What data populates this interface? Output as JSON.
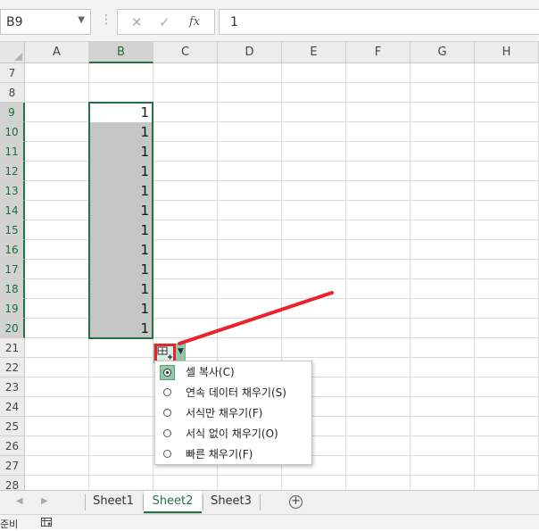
{
  "formula_bar": {
    "name_box": "B9",
    "separator": "⋮",
    "cancel_icon": "✕",
    "enter_icon": "✓",
    "fx_label": "fx",
    "value": "1"
  },
  "columns": [
    "A",
    "B",
    "C",
    "D",
    "E",
    "F",
    "G",
    "H"
  ],
  "selected_column": "B",
  "rows": [
    "7",
    "8",
    "9",
    "10",
    "11",
    "12",
    "13",
    "14",
    "15",
    "16",
    "17",
    "18",
    "19",
    "20",
    "21",
    "22",
    "23",
    "24",
    "25",
    "26",
    "27",
    "28"
  ],
  "selected_rows": [
    "9",
    "10",
    "11",
    "12",
    "13",
    "14",
    "15",
    "16",
    "17",
    "18",
    "19",
    "20"
  ],
  "cells": {
    "B9": "1",
    "B10": "1",
    "B11": "1",
    "B12": "1",
    "B13": "1",
    "B14": "1",
    "B15": "1",
    "B16": "1",
    "B17": "1",
    "B18": "1",
    "B19": "1",
    "B20": "1"
  },
  "autofill_menu": {
    "icon": "autofill-options-icon",
    "items": [
      {
        "label": "셀 복사(C)",
        "selected": true
      },
      {
        "label": "연속 데이터 채우기(S)",
        "selected": false
      },
      {
        "label": "서식만 채우기(F)",
        "selected": false
      },
      {
        "label": "서식 없이 채우기(O)",
        "selected": false
      },
      {
        "label": "빠른 채우기(F)",
        "selected": false
      }
    ]
  },
  "sheet_tabs": [
    {
      "label": "Sheet1",
      "active": false
    },
    {
      "label": "Sheet2",
      "active": true
    },
    {
      "label": "Sheet3",
      "active": false
    }
  ],
  "add_sheet_symbol": "+",
  "status_bar": {
    "text": "준비"
  },
  "colors": {
    "accent": "#217346",
    "selection_fill": "#c6c6c6",
    "highlight_red": "#e8242a",
    "autofill_green": "#8fc9a7"
  }
}
